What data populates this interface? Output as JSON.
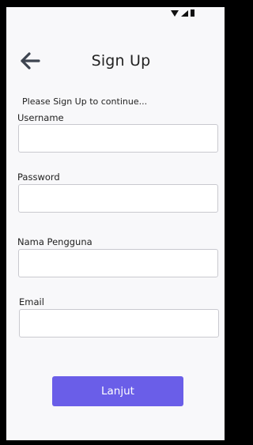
{
  "header": {
    "title": "Sign Up",
    "back_icon": "arrow-left-icon"
  },
  "status_bar": {
    "icons": [
      "wifi-icon",
      "signal-icon",
      "battery-icon"
    ]
  },
  "form": {
    "subtitle": "Please Sign Up to continue...",
    "fields": [
      {
        "label": "Username",
        "value": "",
        "placeholder": ""
      },
      {
        "label": "Password",
        "value": "",
        "placeholder": ""
      },
      {
        "label": "Nama Pengguna",
        "value": "",
        "placeholder": ""
      },
      {
        "label": "Email",
        "value": "",
        "placeholder": ""
      }
    ],
    "submit_label": "Lanjut"
  },
  "colors": {
    "accent": "#6a5ee8",
    "background": "#f8f8fa",
    "frame": "#000000"
  }
}
